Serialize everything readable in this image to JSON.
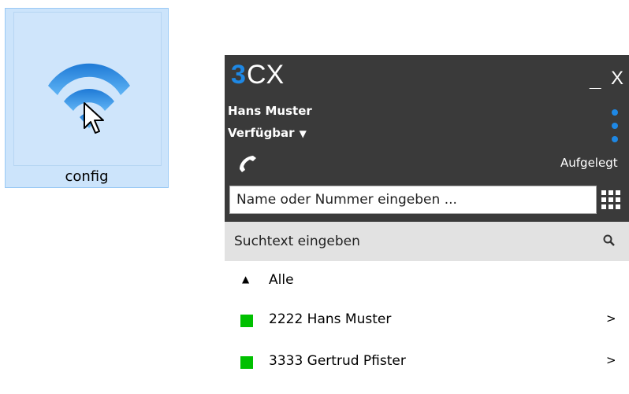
{
  "desktop_icon": {
    "label": "config",
    "icon": "wifi-icon"
  },
  "app": {
    "logo": "3CX",
    "window_controls": {
      "minimize": "_",
      "close": "X"
    },
    "user_name": "Hans Muster",
    "status": "Verfügbar",
    "call_state": "Aufgelegt",
    "dial_placeholder": "Name oder Nummer eingeben ...",
    "search_placeholder": "Suchtext eingeben",
    "colors": {
      "header": "#3a3a3a",
      "accent": "#1e88e5",
      "presence_available": "#00c000",
      "search_bar": "#e2e2e2"
    },
    "group": {
      "label": "Alle"
    },
    "contacts": [
      {
        "label": "2222 Hans Muster",
        "arrow": ">"
      },
      {
        "label": "3333 Gertrud Pfister",
        "arrow": ">"
      }
    ]
  }
}
